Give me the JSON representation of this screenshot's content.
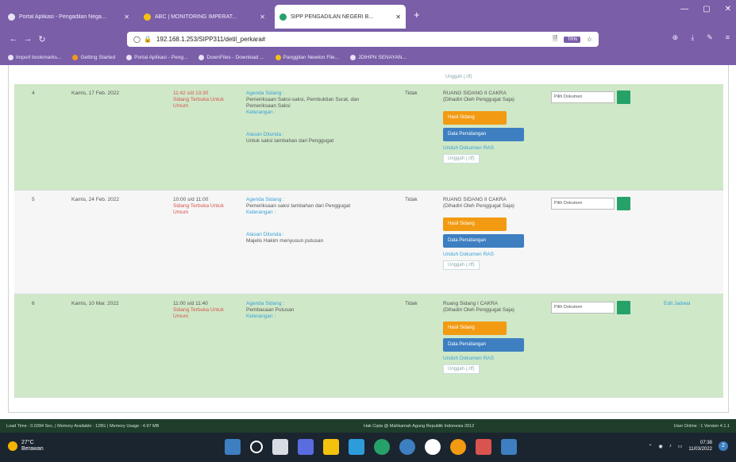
{
  "browser": {
    "tabs": [
      {
        "title": "Portal Aplikasi - Pengadilan Nega...",
        "icon_color": "#e8e2f5"
      },
      {
        "title": "ABC | MONITORING IMPERAT...",
        "icon_color": "#f4c20d"
      },
      {
        "title": "SIPP PENGADILAN NEGERI B...",
        "icon_color": "#26a269",
        "active": true
      }
    ],
    "new_tab": "+",
    "window_controls": [
      "—",
      "▢",
      "✕"
    ],
    "nav": {
      "back": "←",
      "forward": "→",
      "reload": "↻"
    },
    "url": "192.168.1.253/SIPP311/detil_perkara#",
    "url_badge": "TRN",
    "url_icons": {
      "page": "🗎",
      "star": "☆"
    },
    "nav_right": [
      "⊕",
      "⤓",
      "✎",
      "≡"
    ],
    "bookmarks": [
      "Import bookmarks...",
      "Getting Started",
      "Portal Aplikasi - Peng...",
      "DownFiles - Download ...",
      "Panggilan Newton File...",
      "JDIHPN SENAYAN..."
    ]
  },
  "page": {
    "top_upload_label": "Unggah (.rtf)",
    "rows": [
      {
        "no": "4",
        "date": "Kamis, 17 Feb. 2022",
        "time": "11:42 s/d 13:30",
        "session_type": "Sidang Terbuka Untuk Umum",
        "agenda_label": "Agenda Sidang :",
        "agenda_text": "Pemeriksaan Saksi-saksi, Pembuktian Surat, dan Pemeriksaan Saksi",
        "notes_label": "Keterangan :",
        "result_label": "Alasan Ditunda :",
        "result_text": "Untuk saksi tambahan dari Penggugat",
        "status": "Tidak",
        "room": "RUANG SIDANG II CAKRA",
        "room_note": "(Dihadiri Oleh Penggugat Saja)",
        "btn_orange": "Hasil Sidang",
        "btn_blue": "Data Persidangan",
        "upload_doc_label": "Unduh Dokumen RAS",
        "upload_label": "Unggah (.rtf)",
        "select_label": "Pilih Dokumen",
        "edit_label": "",
        "bg": "green"
      },
      {
        "no": "5",
        "date": "Kamis, 24 Feb. 2022",
        "time": "10:00 s/d 11:00",
        "session_type": "Sidang Terbuka Untuk Umum",
        "agenda_label": "Agenda Sidang :",
        "agenda_text": "Pemeriksaan saksi tambahan dari Penggugat",
        "notes_label": "Keterangan :",
        "result_label": "Alasan Ditunda :",
        "result_text": "Majelis Hakim menyusun putusan",
        "status": "Tidak",
        "room": "RUANG SIDANG II CAKRA",
        "room_note": "(Dihadiri Oleh Penggugat Saja)",
        "btn_orange": "Hasil Sidang",
        "btn_blue": "Data Persidangan",
        "upload_doc_label": "Unduh Dokumen RAS",
        "upload_label": "Unggah (.rtf)",
        "select_label": "Pilih Dokumen",
        "edit_label": "",
        "bg": "white"
      },
      {
        "no": "6",
        "date": "Kamis, 10 Mar. 2022",
        "time": "11:00 s/d 11:40",
        "session_type": "Sidang Terbuka Untuk Umum",
        "agenda_label": "Agenda Sidang :",
        "agenda_text": "Pembacaan Putusan",
        "notes_label": "Keterangan :",
        "result_label": "",
        "result_text": "",
        "status": "Tidak",
        "room": "Ruang Sidang I CAKRA",
        "room_note": "(Dihadiri Oleh Penggugat Saja)",
        "btn_orange": "Hasil Sidang",
        "btn_blue": "Data Persidangan",
        "upload_doc_label": "Unduh Dokumen RAS",
        "upload_label": "Unggah (.rtf)",
        "select_label": "Pilih Dokumen",
        "edit_label": "Edit Jadwal",
        "bg": "green"
      }
    ]
  },
  "statusbar": {
    "left": "Load Time : 0.0394 Sec. | Memory Available : 128G | Memory Usage : 4.97 MB",
    "middle": "Hak Cipta @ Mahkamah Agung Republik Indonesia 2012",
    "right": "User Online : 1 Version 4.1.1"
  },
  "taskbar": {
    "temperature": "27°C",
    "weather_text": "Berawan",
    "time": "07:38",
    "date": "11/03/2022",
    "notifications": "2",
    "app_colors": [
      "#3d7fc1",
      "#ffffff",
      "#ffffff",
      "#5b6be0",
      "#f4c20d",
      "#2d9cdb",
      "#26a269",
      "#3d7fc1",
      "#ffffff",
      "#f29a12",
      "#d9534f",
      "#3d7fc1"
    ],
    "tray_icons": [
      "⌃",
      "◉",
      "♪",
      "▭"
    ]
  }
}
